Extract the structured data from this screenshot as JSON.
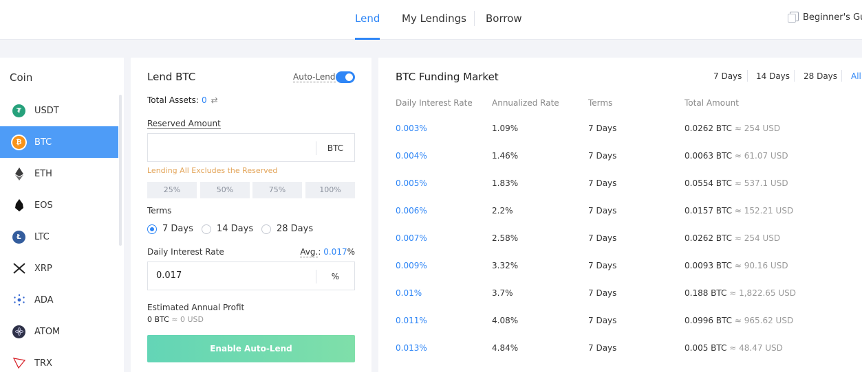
{
  "nav": {
    "tabs": [
      "Lend",
      "My Lendings",
      "Borrow"
    ],
    "active_tab": "Lend",
    "guide": "Beginner's Gu"
  },
  "coins": {
    "title": "Coin",
    "items": [
      {
        "symbol": "USDT",
        "icon": "tether-icon",
        "color": "#26a17b"
      },
      {
        "symbol": "BTC",
        "icon": "bitcoin-icon",
        "color": "#f7931a"
      },
      {
        "symbol": "ETH",
        "icon": "ethereum-icon",
        "color": "#3c3c3d"
      },
      {
        "symbol": "EOS",
        "icon": "eos-icon",
        "color": "#111111"
      },
      {
        "symbol": "LTC",
        "icon": "litecoin-icon",
        "color": "#345d9d"
      },
      {
        "symbol": "XRP",
        "icon": "xrp-icon",
        "color": "#222222"
      },
      {
        "symbol": "ADA",
        "icon": "cardano-icon",
        "color": "#3468d1"
      },
      {
        "symbol": "ATOM",
        "icon": "cosmos-icon",
        "color": "#2e3148"
      },
      {
        "symbol": "TRX",
        "icon": "tron-icon",
        "color": "#d8262d"
      }
    ],
    "selected": "BTC"
  },
  "lend": {
    "title": "Lend BTC",
    "auto_lend_label": "Auto-Lend",
    "auto_lend_on": true,
    "total_assets_label": "Total Assets:",
    "total_assets_value": "0",
    "reserved_label": "Reserved Amount",
    "reserved_value": "",
    "reserved_unit": "BTC",
    "note": "Lending All Excludes the Reserved",
    "percent_buttons": [
      "25%",
      "50%",
      "75%",
      "100%"
    ],
    "terms_label": "Terms",
    "terms": [
      "7 Days",
      "14 Days",
      "28 Days"
    ],
    "selected_term": "7 Days",
    "rate_label": "Daily Interest Rate",
    "avg_label": "Avg.",
    "avg_value": "0.017",
    "avg_unit": "%",
    "rate_value": "0.017",
    "rate_unit": "%",
    "est_label": "Estimated Annual Profit",
    "est_btc": "0 BTC",
    "est_usd": "≈ 0 USD",
    "enable_button": "Enable Auto-Lend"
  },
  "market": {
    "title": "BTC Funding Market",
    "filters": [
      "7 Days",
      "14 Days",
      "28 Days",
      "All"
    ],
    "active_filter": "All",
    "columns": [
      "Daily Interest Rate",
      "Annualized Rate",
      "Terms",
      "Total Amount"
    ],
    "rows": [
      {
        "rate": "0.003%",
        "annual": "1.09%",
        "term": "7 Days",
        "amount": "0.0262 BTC",
        "usd": "≈ 254 USD"
      },
      {
        "rate": "0.004%",
        "annual": "1.46%",
        "term": "7 Days",
        "amount": "0.0063 BTC",
        "usd": "≈ 61.07 USD"
      },
      {
        "rate": "0.005%",
        "annual": "1.83%",
        "term": "7 Days",
        "amount": "0.0554 BTC",
        "usd": "≈ 537.1 USD"
      },
      {
        "rate": "0.006%",
        "annual": "2.2%",
        "term": "7 Days",
        "amount": "0.0157 BTC",
        "usd": "≈ 152.21 USD"
      },
      {
        "rate": "0.007%",
        "annual": "2.58%",
        "term": "7 Days",
        "amount": "0.0262 BTC",
        "usd": "≈ 254 USD"
      },
      {
        "rate": "0.009%",
        "annual": "3.32%",
        "term": "7 Days",
        "amount": "0.0093 BTC",
        "usd": "≈ 90.16 USD"
      },
      {
        "rate": "0.01%",
        "annual": "3.7%",
        "term": "7 Days",
        "amount": "0.188 BTC",
        "usd": "≈ 1,822.65 USD"
      },
      {
        "rate": "0.011%",
        "annual": "4.08%",
        "term": "7 Days",
        "amount": "0.0996 BTC",
        "usd": "≈ 965.62 USD"
      },
      {
        "rate": "0.013%",
        "annual": "4.84%",
        "term": "7 Days",
        "amount": "0.005 BTC",
        "usd": "≈ 48.47 USD"
      }
    ]
  }
}
